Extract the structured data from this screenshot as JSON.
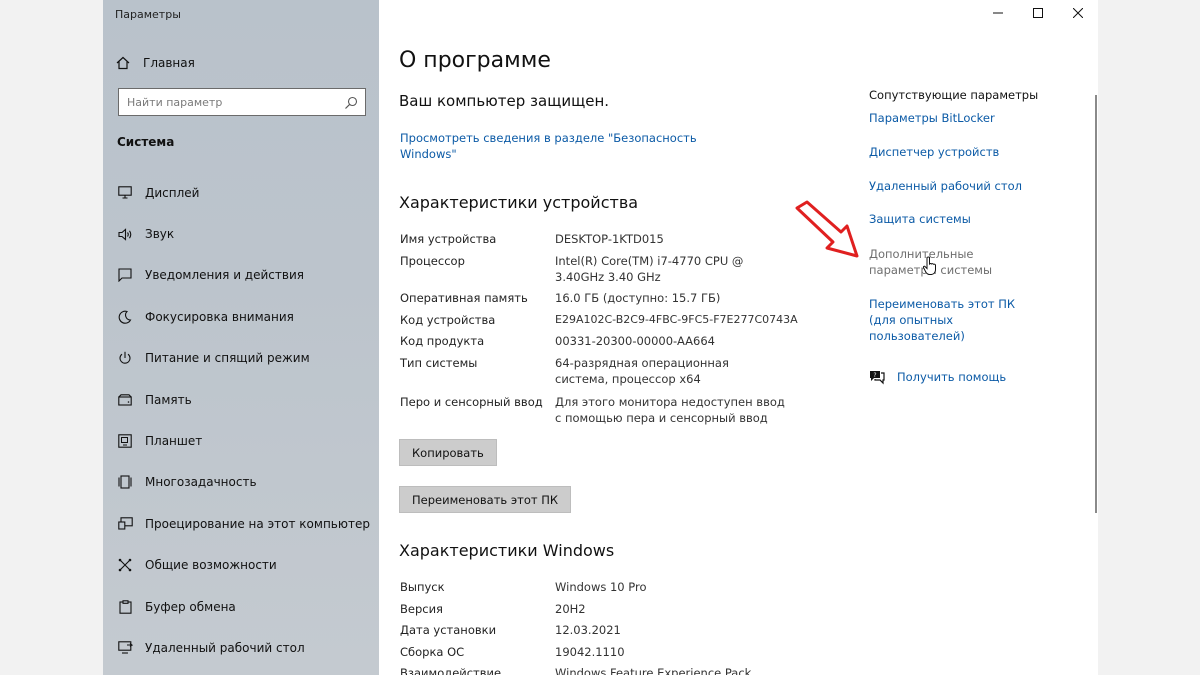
{
  "window": {
    "title": "Параметры",
    "controls": {
      "minimize": "minimize",
      "maximize": "maximize",
      "close": "close"
    }
  },
  "sidebar": {
    "home_label": "Главная",
    "search_placeholder": "Найти параметр",
    "section_title": "Система",
    "items": [
      {
        "label": "Дисплей",
        "icon": "monitor-icon"
      },
      {
        "label": "Звук",
        "icon": "speaker-icon"
      },
      {
        "label": "Уведомления и действия",
        "icon": "notification-icon"
      },
      {
        "label": "Фокусировка внимания",
        "icon": "moon-icon"
      },
      {
        "label": "Питание и спящий режим",
        "icon": "power-icon"
      },
      {
        "label": "Память",
        "icon": "storage-icon"
      },
      {
        "label": "Планшет",
        "icon": "tablet-icon"
      },
      {
        "label": "Многозадачность",
        "icon": "multitasking-icon"
      },
      {
        "label": "Проецирование на этот компьютер",
        "icon": "projecting-icon"
      },
      {
        "label": "Общие возможности",
        "icon": "shared-experiences-icon"
      },
      {
        "label": "Буфер обмена",
        "icon": "clipboard-icon"
      },
      {
        "label": "Удаленный рабочий стол",
        "icon": "remote-desktop-icon"
      }
    ]
  },
  "main": {
    "title": "О программе",
    "protected_text": "Ваш компьютер защищен.",
    "security_link": "Просмотреть сведения в разделе \"Безопасность Windows\"",
    "device_specs": {
      "heading": "Характеристики устройства",
      "rows": [
        {
          "key": "Имя устройства",
          "value": "DESKTOP-1KTD015"
        },
        {
          "key": "Процессор",
          "value": "Intel(R) Core(TM) i7-4770 CPU @ 3.40GHz 3.40 GHz"
        },
        {
          "key": "Оперативная память",
          "value": "16.0 ГБ (доступно: 15.7 ГБ)"
        },
        {
          "key": "Код устройства",
          "value": "E29A102C-B2C9-4FBC-9FC5-F7E277C0743A"
        },
        {
          "key": "Код продукта",
          "value": "00331-20300-00000-AA664"
        },
        {
          "key": "Тип системы",
          "value": "64-разрядная операционная система, процессор x64"
        },
        {
          "key": "Перо и сенсорный ввод",
          "value": "Для этого монитора недоступен ввод с помощью пера и сенсорный ввод"
        }
      ],
      "copy_button": "Копировать",
      "rename_button": "Переименовать этот ПК"
    },
    "windows_specs": {
      "heading": "Характеристики Windows",
      "rows": [
        {
          "key": "Выпуск",
          "value": "Windows 10 Pro"
        },
        {
          "key": "Версия",
          "value": "20H2"
        },
        {
          "key": "Дата установки",
          "value": "12.03.2021"
        },
        {
          "key": "Сборка ОС",
          "value": "19042.1110"
        },
        {
          "key": "Взаимодействие",
          "value": "Windows Feature Experience Pack"
        }
      ]
    }
  },
  "related": {
    "title": "Сопутствующие параметры",
    "links": [
      "Параметры BitLocker",
      "Диспетчер устройств",
      "Удаленный рабочий стол",
      "Защита системы",
      "Дополнительные параметры системы",
      "Переименовать этот ПК (для опытных пользователей)"
    ],
    "help_label": "Получить помощь"
  },
  "colors": {
    "link": "#0b5aa6",
    "annotation_arrow": "#e02020"
  }
}
